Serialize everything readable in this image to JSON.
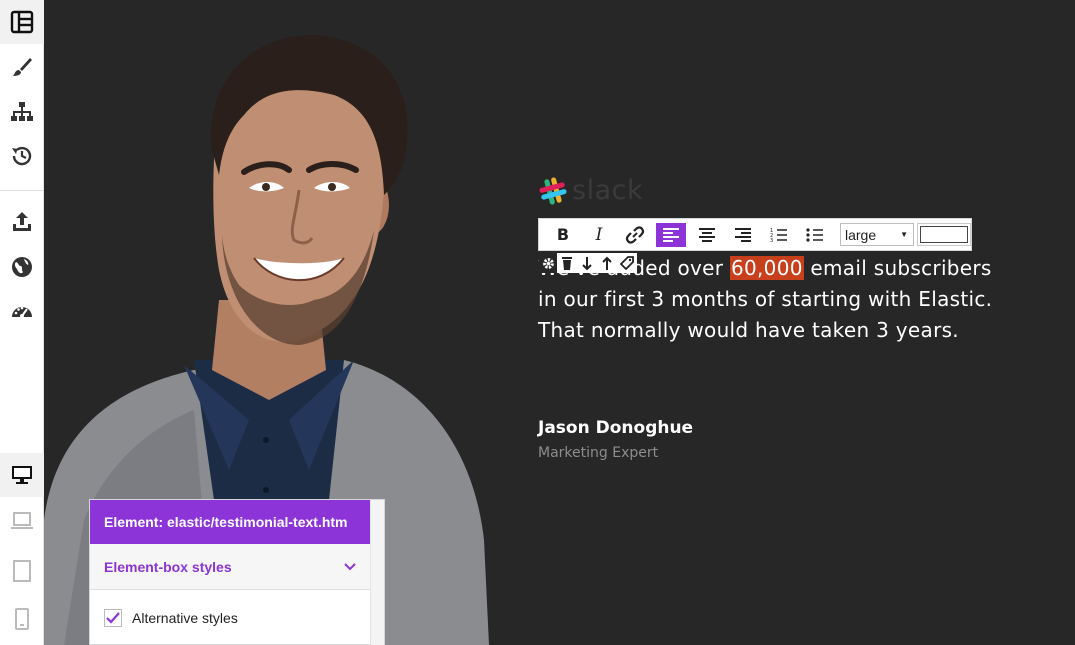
{
  "sidebar": {
    "items": [
      {
        "icon": "layout-icon",
        "active": true
      },
      {
        "icon": "paintbrush-icon"
      },
      {
        "icon": "sitemap-icon"
      },
      {
        "icon": "history-icon"
      },
      {
        "icon": "export-icon"
      },
      {
        "icon": "globe-icon"
      },
      {
        "icon": "dashboard-icon"
      },
      {
        "icon": "desktop-icon",
        "active": true
      },
      {
        "icon": "laptop-icon"
      },
      {
        "icon": "tablet-icon"
      },
      {
        "icon": "phone-icon"
      }
    ]
  },
  "brand": {
    "logo_text": "slack"
  },
  "editor_toolbar": {
    "bold_label": "B",
    "italic_label": "I",
    "font_size": "large",
    "active_tool": "align-left"
  },
  "testimonial": {
    "quote_before": "We've added over ",
    "quote_highlight": "60,000",
    "quote_after": " email subscribers in our first 3 months of starting with Elastic. That normally would have taken 3 years.",
    "author": "Jason Donoghue",
    "role": "Marketing Expert"
  },
  "panel": {
    "header": "Element: elastic/testimonial-text.htm",
    "section": "Element-box styles",
    "option_label": "Alternative styles",
    "option_checked": true
  },
  "colors": {
    "accent": "#8c34d8",
    "highlight": "#c8401b",
    "background": "#272727"
  }
}
